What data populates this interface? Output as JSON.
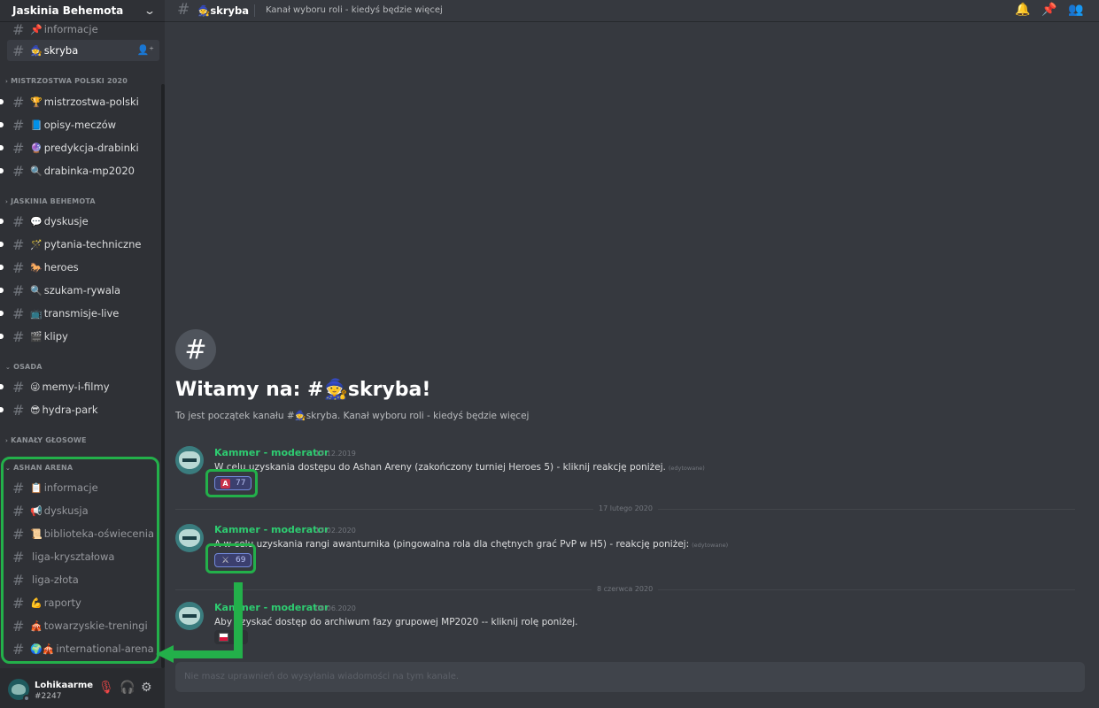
{
  "server": {
    "name": "Jaskinia Behemota"
  },
  "sidebar": {
    "top_channels": [
      {
        "emoji": "📌",
        "name": "informacje"
      },
      {
        "emoji": "🧙",
        "name": "skryba"
      }
    ],
    "categories": [
      {
        "name": "MISTRZOSTWA POLSKI 2020",
        "channels": [
          {
            "emoji": "🏆",
            "name": "mistrzostwa-polski"
          },
          {
            "emoji": "📘",
            "name": "opisy-meczów"
          },
          {
            "emoji": "🔮",
            "name": "predykcja-drabinki"
          },
          {
            "emoji": "🔍",
            "name": "drabinka-mp2020"
          }
        ]
      },
      {
        "name": "JASKINIA BEHEMOTA",
        "channels": [
          {
            "emoji": "💬",
            "name": "dyskusje"
          },
          {
            "emoji": "🪄",
            "name": "pytania-techniczne"
          },
          {
            "emoji": "🐎",
            "name": "heroes"
          },
          {
            "emoji": "🔍",
            "name": "szukam-rywala"
          },
          {
            "emoji": "📺",
            "name": "transmisje-live"
          },
          {
            "emoji": "🎬",
            "name": "klipy"
          }
        ]
      },
      {
        "name": "OSADA",
        "channels": [
          {
            "emoji": "😜",
            "name": "memy-i-filmy"
          },
          {
            "emoji": "😎",
            "name": "hydra-park"
          }
        ]
      },
      {
        "name": "KANAŁY GŁOSOWE",
        "channels": []
      },
      {
        "name": "ASHAN ARENA",
        "channels": [
          {
            "emoji": "📋",
            "name": "informacje"
          },
          {
            "emoji": "📢",
            "name": "dyskusja"
          },
          {
            "emoji": "📜",
            "name": "biblioteka-oświecenia"
          },
          {
            "emoji": "",
            "name": "liga-kryształowa"
          },
          {
            "emoji": "",
            "name": "liga-złota"
          },
          {
            "emoji": "💪",
            "name": "raporty"
          },
          {
            "emoji": "🎪",
            "name": "towarzyskie-treningi"
          },
          {
            "emoji": "🌍🎪",
            "name": "international-arena"
          }
        ]
      }
    ]
  },
  "user": {
    "name": "Lohikaarme",
    "tag": "#2247"
  },
  "topbar": {
    "channel_emoji": "🧙",
    "channel": "skryba",
    "topic": "Kanał wyboru roli - kiedyś będzie więcej"
  },
  "welcome": {
    "title": "Witamy na: #🧙skryba!",
    "subtitle": "To jest początek kanału #🧙skryba. Kanał wyboru roli - kiedyś będzie więcej"
  },
  "messages": [
    {
      "author": "Kammer - moderator",
      "date": "17.12.2019",
      "text": "W celu uzyskania dostępu do Ashan Areny (zakończony turniej Heroes 5) - kliknij reakcję poniżej.",
      "edited": "(edytowane)",
      "reaction_emoji": "A",
      "reaction_count": "77"
    },
    {
      "author": "Kammer - moderator",
      "date": "17.02.2020",
      "text": "A w celu uzyskania rangi awanturnika (pingowalna rola dla chętnych grać PvP w H5) - reakcję poniżej:",
      "edited": "(edytowane)",
      "reaction_emoji": "⚔",
      "reaction_count": "69"
    },
    {
      "author": "Kammer - moderator",
      "date": "08.06.2020",
      "text": "Aby uzyskać dostęp do archiwum fazy grupowej MP2020 -- kliknij rolę poniżej.",
      "edited": "",
      "reaction_emoji": "",
      "reaction_count": ""
    }
  ],
  "dividers": [
    "17 lutego 2020",
    "8 czerwca 2020"
  ],
  "input": {
    "placeholder": "Nie masz uprawnień do wysyłania wiadomości na tym kanale."
  },
  "colors": {
    "highlight": "#23b04a",
    "author": "#2ecc71",
    "background": "#36393f",
    "sidebar": "#2f3136"
  }
}
